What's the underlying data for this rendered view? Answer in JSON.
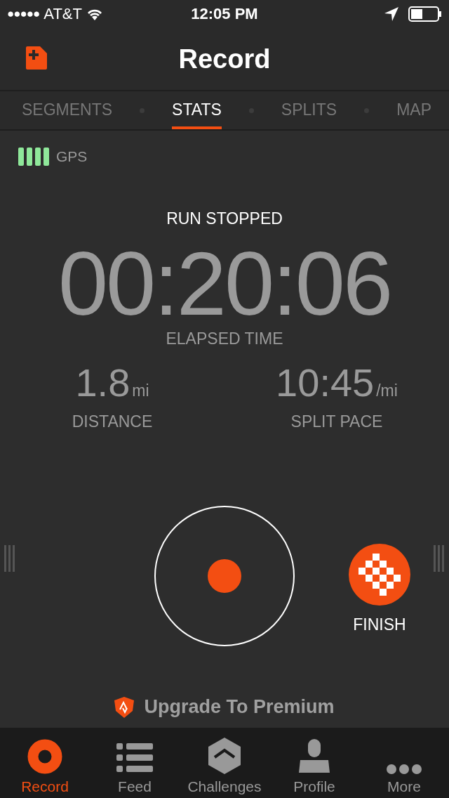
{
  "status_bar": {
    "signal_dots": "●●●●●",
    "carrier": "AT&T",
    "time": "12:05 PM"
  },
  "header": {
    "title": "Record"
  },
  "tabs": [
    {
      "label": "SEGMENTS",
      "selected": false
    },
    {
      "label": "STATS",
      "selected": true
    },
    {
      "label": "SPLITS",
      "selected": false
    },
    {
      "label": "MAP",
      "selected": false
    }
  ],
  "gps": {
    "label": "GPS"
  },
  "run": {
    "status": "RUN STOPPED",
    "elapsed": "00:20:06",
    "elapsed_label": "ELAPSED TIME"
  },
  "stats": [
    {
      "value": "1.8",
      "unit": "mi",
      "label": "DISTANCE"
    },
    {
      "value": "10:45",
      "unit": "/mi",
      "label": "SPLIT PACE"
    }
  ],
  "finish": {
    "label": "FINISH"
  },
  "upgrade": {
    "label": "Upgrade To Premium"
  },
  "nav": [
    {
      "label": "Record",
      "kind": "record",
      "selected": true
    },
    {
      "label": "Feed",
      "kind": "feed",
      "selected": false
    },
    {
      "label": "Challenges",
      "kind": "challenges",
      "selected": false
    },
    {
      "label": "Profile",
      "kind": "profile",
      "selected": false
    },
    {
      "label": "More",
      "kind": "more",
      "selected": false
    }
  ]
}
